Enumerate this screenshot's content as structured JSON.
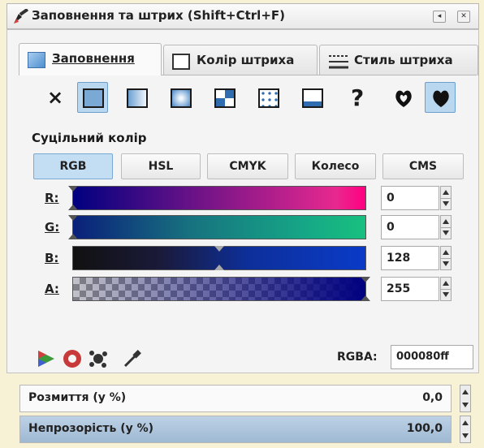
{
  "window": {
    "title": "Заповнення та штрих (Shift+Ctrl+F)",
    "buttons": [
      "restore",
      "close"
    ]
  },
  "tabs": [
    {
      "label": "Заповнення",
      "icon": "fill-icon",
      "active": true
    },
    {
      "label": "Колір штриха",
      "icon": "stroke-paint-icon",
      "active": false
    },
    {
      "label": "Стиль штриха",
      "icon": "stroke-style-icon",
      "active": false
    }
  ],
  "fill_types": [
    {
      "name": "none",
      "glyph": "×"
    },
    {
      "name": "flat",
      "selected": true
    },
    {
      "name": "linear-gradient"
    },
    {
      "name": "radial-gradient"
    },
    {
      "name": "mesh"
    },
    {
      "name": "pattern"
    },
    {
      "name": "swatch"
    },
    {
      "name": "unset",
      "glyph": "?"
    },
    {
      "name": "fill-rule-evenodd"
    },
    {
      "name": "fill-rule-nonzero",
      "selected": true
    }
  ],
  "heading": "Суцільний колір",
  "modes": [
    {
      "label": "RGB",
      "active": true
    },
    {
      "label": "HSL",
      "active": false
    },
    {
      "label": "CMYK",
      "active": false
    },
    {
      "label": "Колесо",
      "active": false
    },
    {
      "label": "CMS",
      "active": false
    }
  ],
  "channels": [
    {
      "label": "R:",
      "value": "0"
    },
    {
      "label": "G:",
      "value": "0"
    },
    {
      "label": "B:",
      "value": "128"
    },
    {
      "label": "A:",
      "value": "255"
    }
  ],
  "rgba": {
    "label": "RGBA:",
    "value": "000080ff"
  },
  "blur": {
    "label": "Розмиття (у %)",
    "value": "0,0"
  },
  "opacity": {
    "label": "Непрозорість (у %)",
    "value": "100,0"
  },
  "colors": {
    "selected_blue": "#b9d7ef",
    "current_color": "#000080"
  }
}
